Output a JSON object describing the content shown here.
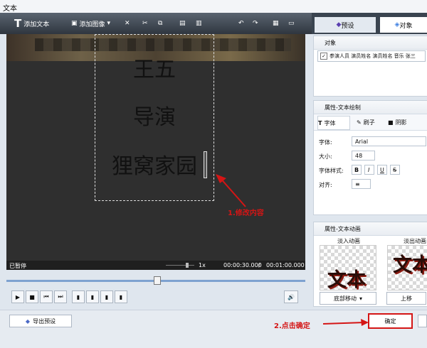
{
  "app": {
    "title": "文本"
  },
  "toolbar": {
    "add_text": "添加文本",
    "add_image": "添加图像",
    "dropdown_arrow": "▾"
  },
  "preview": {
    "lines": [
      "王五",
      "导演",
      "狸窝家园"
    ],
    "status": "已暂停",
    "speed": "1x",
    "current_time": "00:00:30.000",
    "separator": " / ",
    "total_time": "00:01:00.000"
  },
  "right_tabs": {
    "preset": "预设",
    "object": "对象"
  },
  "object_panel": {
    "title": "对象",
    "item": "参演人员 演员姓名 演员姓名 音乐 张三"
  },
  "text_props": {
    "title": "属性-文本绘制",
    "tabs": {
      "font": "字体",
      "brush": "刷子",
      "shadow": "阴影"
    },
    "font_label": "字体:",
    "font_value": "Arial",
    "size_label": "大小:",
    "size_value": "48",
    "style_label": "字体样式:",
    "align_label": "对齐:",
    "style_buttons": [
      "B",
      "I",
      "U",
      "S"
    ]
  },
  "animation": {
    "title": "属性-文本动画",
    "fade_in_label": "淡入动画",
    "fade_out_label": "淡出动画",
    "sample_text": "文本",
    "fade_in_option": "底部移动",
    "fade_out_option": "上移"
  },
  "footer": {
    "export_preset": "导出预设",
    "ok": "确定"
  },
  "annotations": {
    "a1": "1.修改内容",
    "a2": "2.点击确定"
  },
  "colors": {
    "annotation": "#d41515",
    "dark_toolbar": "#2f363f",
    "preview": "#2f2f2f"
  },
  "icons": [
    "text-icon",
    "image-icon",
    "close-icon",
    "cut-icon",
    "copy-icon",
    "align-icon",
    "undo-icon",
    "redo-icon",
    "grid-icon",
    "monitor-icon"
  ]
}
